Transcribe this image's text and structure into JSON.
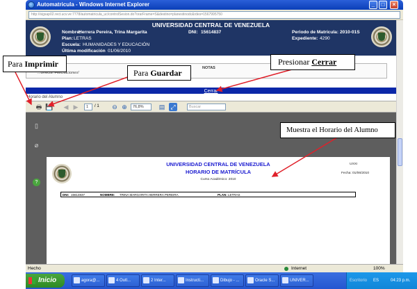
{
  "window": {
    "title": "Automatricula - Windows Internet Explorer",
    "url": "http://sigsap02.rect.ucv.ve:7778/automatricula_uc/controlSesion.do?orarFrame=S&destino=planestinodc&rdes=1567995750"
  },
  "header": {
    "university": "UNIVERSIDAD CENTRAL DE VENEZUELA",
    "nombre_label": "Nombre:",
    "nombre_value": "Herrera Pereira, Trina Margarita",
    "dni_label": "DNI:",
    "dni_value": "15614837",
    "periodo_label": "Periodo de Matrícula:",
    "periodo_value": "2010-01S",
    "plan_label": "Plan:",
    "plan_value": "LETRAS",
    "expediente_label": "Expediente:",
    "expediente_value": "4290",
    "escuela_label": "Escuela:",
    "escuela_value": "HUMANIDADES Y EDUCACIÓN",
    "modificacion_label": "Última modificación",
    "modificacion_value": "01/06/2010"
  },
  "notas": {
    "title": "NOTAS",
    "message": "...orrecta !Felicitaciones!"
  },
  "close_link": "Cerrar",
  "section_label": "Horario del Alumno",
  "pdf_toolbar": {
    "page_current": "1",
    "page_total": "/ 1",
    "zoom": "76,8%",
    "search_placeholder": "Buscar"
  },
  "document": {
    "university": "UNIVERSIDAD CENTRAL DE VENEZUELA",
    "title": "HORARIO DE MATRÍCULA",
    "course_year": "Curso Académico: 2010",
    "code": "UXXI",
    "date": "Fecha: 01/06/2010",
    "dni_label": "DNI:",
    "dni_value": "15614837",
    "nombre_label": "NOMBRE:",
    "nombre_value": "TRINA MARGARITA HERRERA PEREIRA",
    "plan_label": "PLAN:",
    "plan_value": "LETRAS"
  },
  "statusbar": {
    "left": "Hecho",
    "zone": "Internet",
    "zoom": "100%"
  },
  "taskbar": {
    "start": "Inicio",
    "tasks": [
      "agora@...",
      "4 Outl...",
      "2 Inter...",
      "Instructi...",
      "Dibujo - ...",
      "Oracle S...",
      "UNIVER..."
    ],
    "tray_label": "Escritorio",
    "lang": "ES",
    "clock": "04:23 p.m."
  },
  "annotations": {
    "imprimir_prefix": "Para ",
    "imprimir_bold": "Imprimir",
    "guardar_prefix": "Para ",
    "guardar_bold": "Guardar",
    "cerrar_prefix": "Presionar ",
    "cerrar_bold": "Cerrar",
    "horario": "Muestra el Horario del Alumno"
  },
  "colors": {
    "header_bg": "#1f3565",
    "close_bar": "#0b27a8",
    "doc_title": "#1a1ad0",
    "arrow": "#e0202a"
  }
}
